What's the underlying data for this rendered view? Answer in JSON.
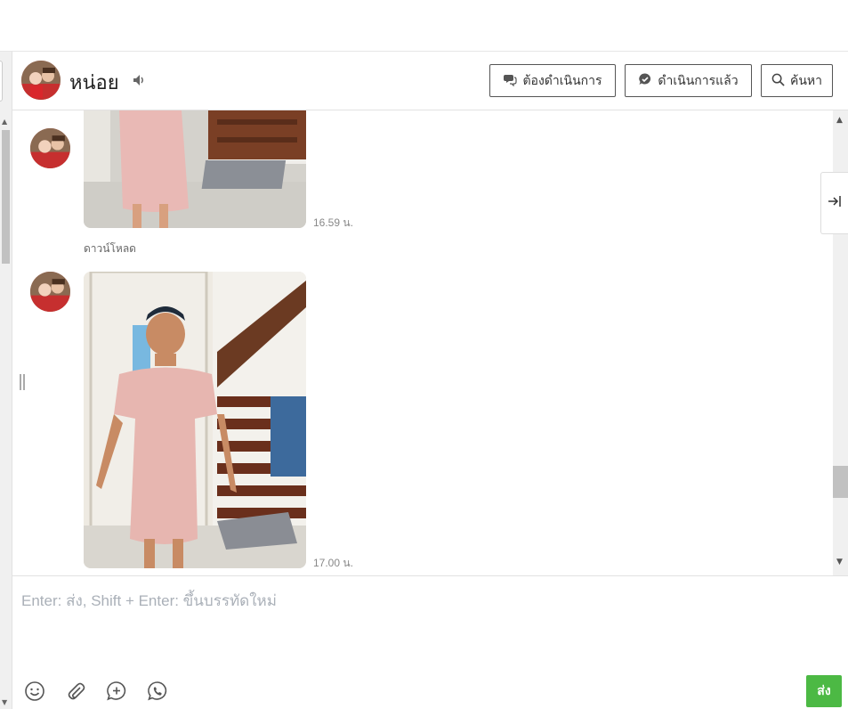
{
  "header": {
    "contact_name": "หน่อย",
    "buttons": {
      "todo": "ต้องดำเนินการ",
      "done": "ดำเนินการแล้ว",
      "search": "ค้นหา"
    }
  },
  "messages": [
    {
      "type": "image",
      "time": "16.59 น.",
      "download_label": "ดาวน์โหลด"
    },
    {
      "type": "image",
      "time": "17.00 น."
    }
  ],
  "composer": {
    "placeholder": "Enter: ส่ง, Shift + Enter: ขึ้นบรรทัดใหม่",
    "send_label": "ส่ง",
    "tools": [
      "emoji-icon",
      "attachment-icon",
      "add-comment-icon",
      "phone-icon"
    ]
  },
  "colors": {
    "send_button": "#4cb944",
    "placeholder": "#aab0b8"
  }
}
